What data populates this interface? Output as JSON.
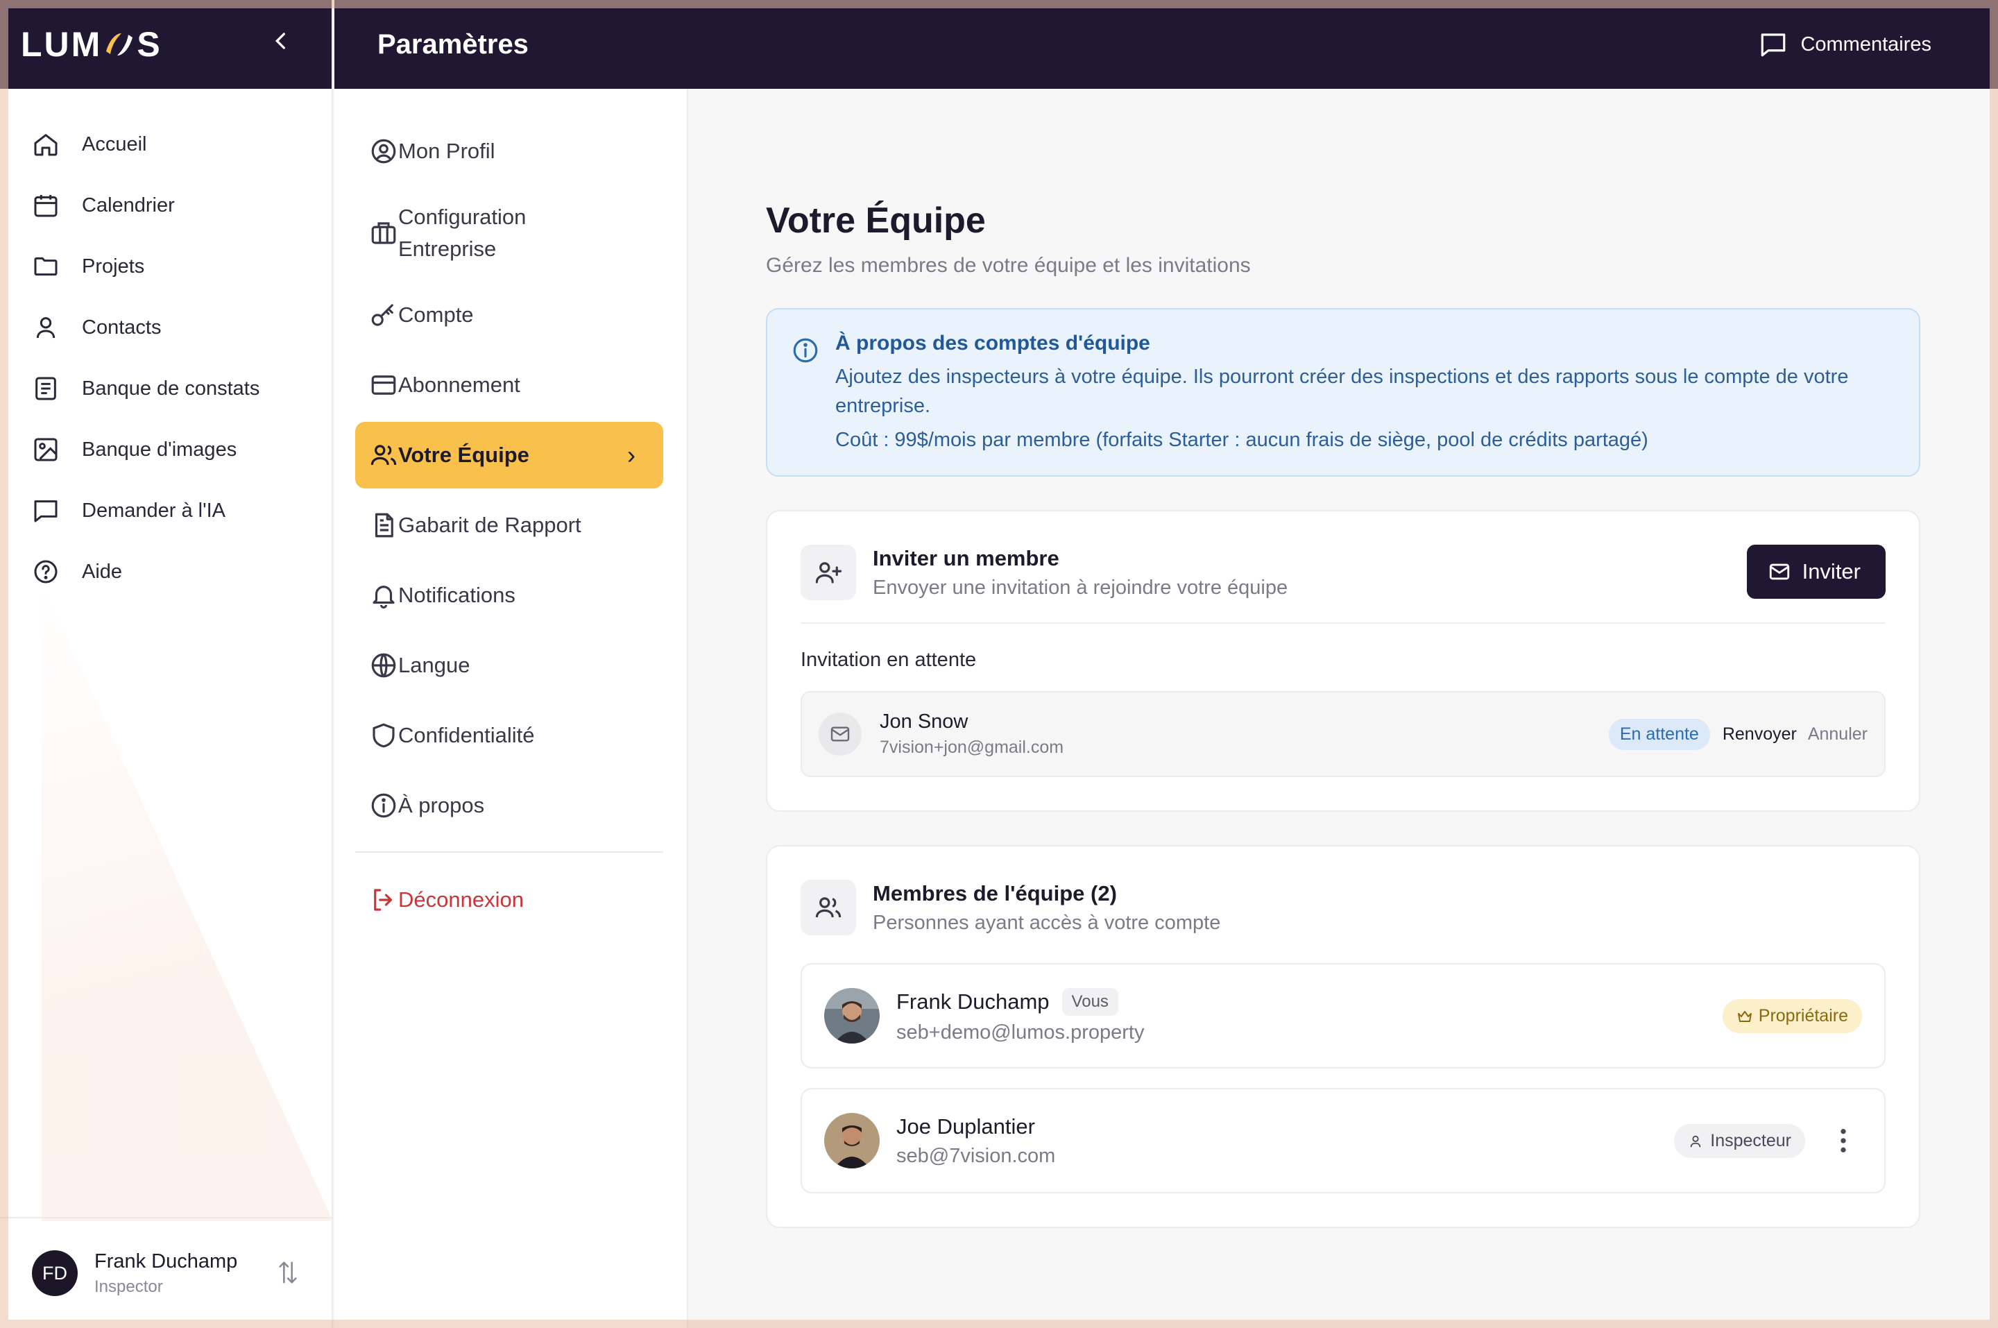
{
  "app": {
    "logo": "LUMOS",
    "collapse_icon": "chevron-left-icon"
  },
  "sidebar": {
    "items": [
      {
        "label": "Accueil",
        "icon": "home-icon"
      },
      {
        "label": "Calendrier",
        "icon": "calendar-icon"
      },
      {
        "label": "Projets",
        "icon": "folder-icon"
      },
      {
        "label": "Contacts",
        "icon": "user-icon"
      },
      {
        "label": "Banque de constats",
        "icon": "document-list-icon"
      },
      {
        "label": "Banque d'images",
        "icon": "image-icon"
      },
      {
        "label": "Demander à l'IA",
        "icon": "chat-icon"
      },
      {
        "label": "Aide",
        "icon": "help-icon"
      }
    ],
    "user": {
      "initials": "FD",
      "name": "Frank Duchamp",
      "role": "Inspector"
    }
  },
  "header": {
    "title": "Paramètres",
    "feedback_label": "Commentaires"
  },
  "settings_menu": {
    "items": [
      {
        "label": "Mon Profil",
        "icon": "user-circle-icon"
      },
      {
        "label": "Configuration Entreprise",
        "icon": "briefcase-icon"
      },
      {
        "label": "Compte",
        "icon": "key-icon"
      },
      {
        "label": "Abonnement",
        "icon": "credit-card-icon"
      },
      {
        "label": "Votre Équipe",
        "icon": "users-icon",
        "active": true
      },
      {
        "label": "Gabarit de Rapport",
        "icon": "file-text-icon"
      },
      {
        "label": "Notifications",
        "icon": "bell-icon"
      },
      {
        "label": "Langue",
        "icon": "globe-icon"
      },
      {
        "label": "Confidentialité",
        "icon": "shield-icon"
      },
      {
        "label": "À propos",
        "icon": "info-icon"
      }
    ],
    "logout_label": "Déconnexion"
  },
  "main": {
    "title": "Votre Équipe",
    "subtitle": "Gérez les membres de votre équipe et les invitations",
    "info": {
      "title": "À propos des comptes d'équipe",
      "text": "Ajoutez des inspecteurs à votre équipe. Ils pourront créer des inspections et des rapports sous le compte de votre entreprise.",
      "cost": "Coût : 99$/mois par membre (forfaits Starter : aucun frais de siège, pool de crédits partagé)"
    },
    "invite_card": {
      "title": "Inviter un membre",
      "subtitle": "Envoyer une invitation à rejoindre votre équipe",
      "button_label": "Inviter",
      "pending_label": "Invitation en attente",
      "pending": {
        "name": "Jon Snow",
        "email": "7vision+jon@gmail.com",
        "status": "En attente",
        "resend": "Renvoyer",
        "cancel": "Annuler"
      }
    },
    "members_card": {
      "title": "Membres de l'équipe (2)",
      "subtitle": "Personnes ayant accès à votre compte",
      "members": [
        {
          "name": "Frank Duchamp",
          "you_badge": "Vous",
          "email": "seb+demo@lumos.property",
          "role": "Propriétaire"
        },
        {
          "name": "Joe Duplantier",
          "email": "seb@7vision.com",
          "role": "Inspecteur"
        }
      ]
    }
  },
  "colors": {
    "dark": "#201832",
    "accent": "#f9c04c",
    "danger": "#c8353a",
    "info_bg": "#eaf3fb",
    "info_text": "#2b5e9a"
  }
}
